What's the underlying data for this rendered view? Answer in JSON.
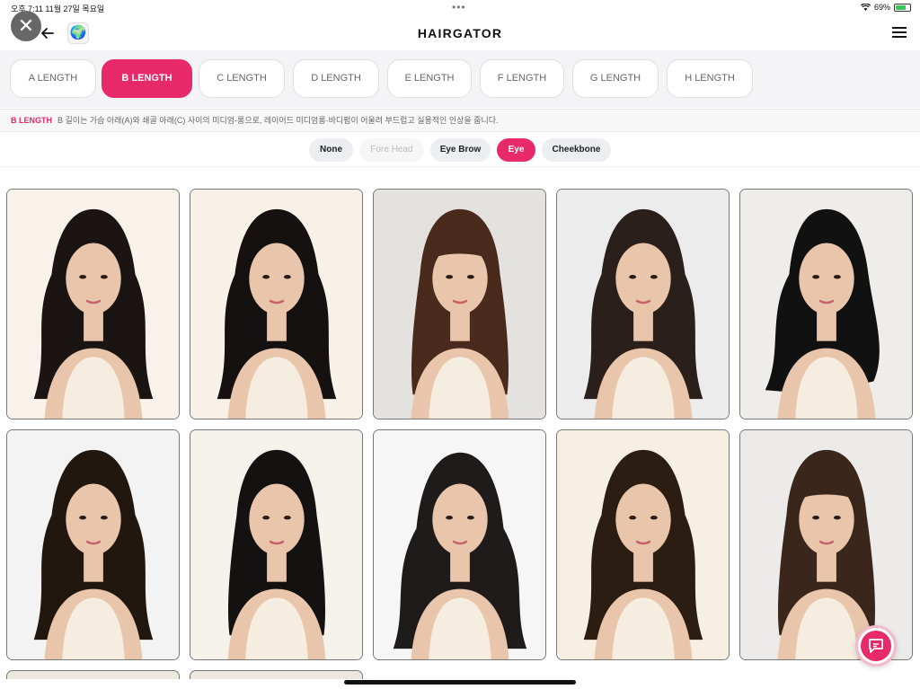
{
  "status_bar": {
    "time_date": "오후 7:11   11월 27일 목요일",
    "battery": "69%"
  },
  "header": {
    "title": "HAIRGATOR",
    "close_icon": "✕",
    "globe_icon": "🌍"
  },
  "length_tabs": [
    {
      "label": "A LENGTH"
    },
    {
      "label": "B LENGTH",
      "active": true
    },
    {
      "label": "C LENGTH"
    },
    {
      "label": "D LENGTH"
    },
    {
      "label": "E LENGTH"
    },
    {
      "label": "F LENGTH"
    },
    {
      "label": "G LENGTH"
    },
    {
      "label": "H LENGTH"
    }
  ],
  "description": {
    "tag": "B LENGTH",
    "text": "B 길이는 가슴 아래(A)와 쇄골 아래(C) 사이의 미디엄-롱으로, 레이어드 미디엄롱·바디펌이 어울려 부드럽고 실용적인 인상을 줍니다."
  },
  "filters": [
    {
      "label": "None"
    },
    {
      "label": "Fore Head",
      "disabled": true
    },
    {
      "label": "Eye Brow"
    },
    {
      "label": "Eye",
      "active": true
    },
    {
      "label": "Cheekbone"
    }
  ],
  "colors": {
    "accent": "#e8296a",
    "accent_light": "#f4b9cd"
  },
  "gallery": [
    {
      "bg": "#f7f2ea",
      "hair": "#1a1512",
      "style": "wavy"
    },
    {
      "bg": "#f7f1e8",
      "hair": "#141110",
      "style": "wavy"
    },
    {
      "bg": "#e4e2df",
      "hair": "#4a2a1c",
      "style": "straight-bangs"
    },
    {
      "bg": "#ececec",
      "hair": "#2a1f1a",
      "style": "wavy"
    },
    {
      "bg": "#efede9",
      "hair": "#111111",
      "style": "side-wave"
    },
    {
      "bg": "#f3f3f3",
      "hair": "#22170f",
      "style": "wavy"
    },
    {
      "bg": "#f5f2ec",
      "hair": "#141211",
      "style": "straight"
    },
    {
      "bg": "#f6f6f6",
      "hair": "#1e1b1a",
      "style": "big-wave"
    },
    {
      "bg": "#f6efe2",
      "hair": "#2b1d12",
      "style": "wavy"
    },
    {
      "bg": "#ecebea",
      "hair": "#3a261a",
      "style": "straight-bangs"
    }
  ],
  "icons": {
    "close": "close-icon",
    "back": "arrow-left-icon",
    "globe": "globe-icon",
    "menu": "hamburger-menu-icon",
    "chat": "chat-bubble-icon"
  }
}
